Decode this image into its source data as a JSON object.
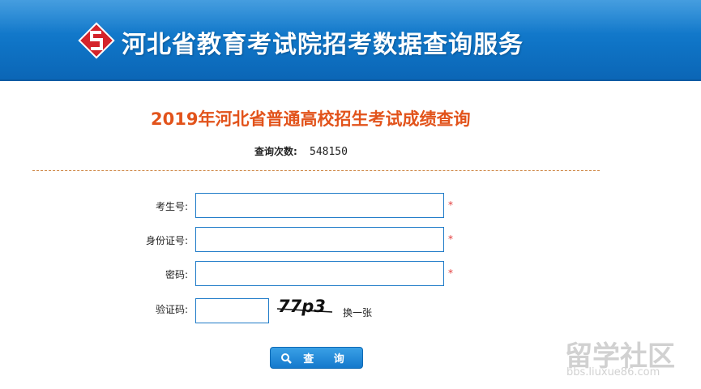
{
  "header": {
    "site_title": "河北省教育考试院招考数据查询服务",
    "logo_icon": "hebei-exam-logo-icon",
    "brand_color": "#1078c8"
  },
  "main": {
    "title": "2019年河北省普通高校招生考试成绩查询",
    "title_color": "#e2531b",
    "query_count_label": "查询次数:",
    "query_count_value": "548150"
  },
  "form": {
    "exam_number": {
      "label": "考生号:",
      "value": "",
      "required_mark": "*"
    },
    "id_number": {
      "label": "身份证号:",
      "value": "",
      "required_mark": "*"
    },
    "password": {
      "label": "密码:",
      "value": "",
      "required_mark": "*"
    },
    "captcha": {
      "label": "验证码:",
      "value": "",
      "image_text": "77p3",
      "refresh_label": "换一张"
    },
    "submit_label": "查 询",
    "submit_icon": "search-icon"
  },
  "watermark": {
    "title": "留学社区",
    "subtitle": "bbs.liuxue86.com"
  }
}
